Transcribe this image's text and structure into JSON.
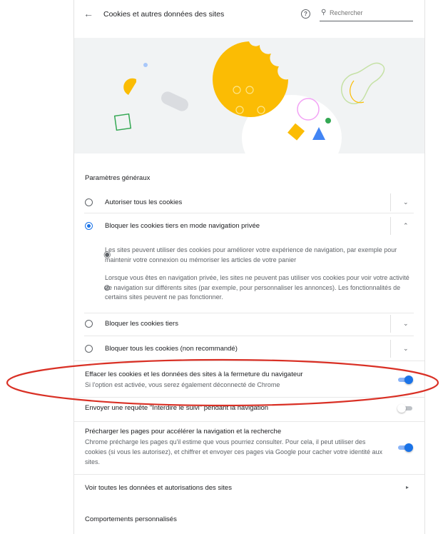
{
  "header": {
    "back_icon": "arrow-left-icon",
    "title": "Cookies et autres données des sites",
    "help_icon": "help-circle-icon",
    "search_icon": "search-icon",
    "search_placeholder": "Rechercher"
  },
  "section_title": "Paramètres généraux",
  "cookie_options": [
    {
      "label": "Autoriser tous les cookies",
      "selected": false,
      "expanded": false
    },
    {
      "label": "Bloquer les cookies tiers en mode navigation privée",
      "selected": true,
      "expanded": true
    },
    {
      "label": "Bloquer les cookies tiers",
      "selected": false,
      "expanded": false
    },
    {
      "label": "Bloquer tous les cookies (non recommandé)",
      "selected": false,
      "expanded": false
    }
  ],
  "expanded_details": [
    {
      "icon": "cookie-icon",
      "text": "Les sites peuvent utiliser des cookies pour améliorer votre expérience de navigation, par exemple pour maintenir votre connexion ou mémoriser les articles de votre panier"
    },
    {
      "icon": "block-icon",
      "text": "Lorsque vous êtes en navigation privée, les sites ne peuvent pas utiliser vos cookies pour voir votre activité de navigation sur différents sites (par exemple, pour personnaliser les annonces). Les fonctionnalités de certains sites peuvent ne pas fonctionner."
    }
  ],
  "toggles": {
    "clear_on_exit": {
      "title": "Effacer les cookies et les données des sites à la fermeture du navigateur",
      "subtitle": "Si l'option est activée, vous serez également déconnecté de Chrome",
      "on": true
    },
    "do_not_track": {
      "title": "Envoyer une requête \"Interdire le suivi\" pendant la navigation",
      "on": false
    },
    "preload": {
      "title": "Précharger les pages pour accélérer la navigation et la recherche",
      "subtitle": "Chrome précharge les pages qu'il estime que vous pourriez consulter. Pour cela, il peut utiliser des cookies (si vous les autorisez), et chiffrer et envoyer ces pages via Google pour cacher votre identité aux sites.",
      "on": true
    }
  },
  "all_data_link": "Voir toutes les données et autorisations des sites",
  "custom_behaviors_title": "Comportements personnalisés",
  "colors": {
    "accent": "#1a73e8",
    "cookie": "#fbbc04",
    "annotation": "#d93025"
  }
}
